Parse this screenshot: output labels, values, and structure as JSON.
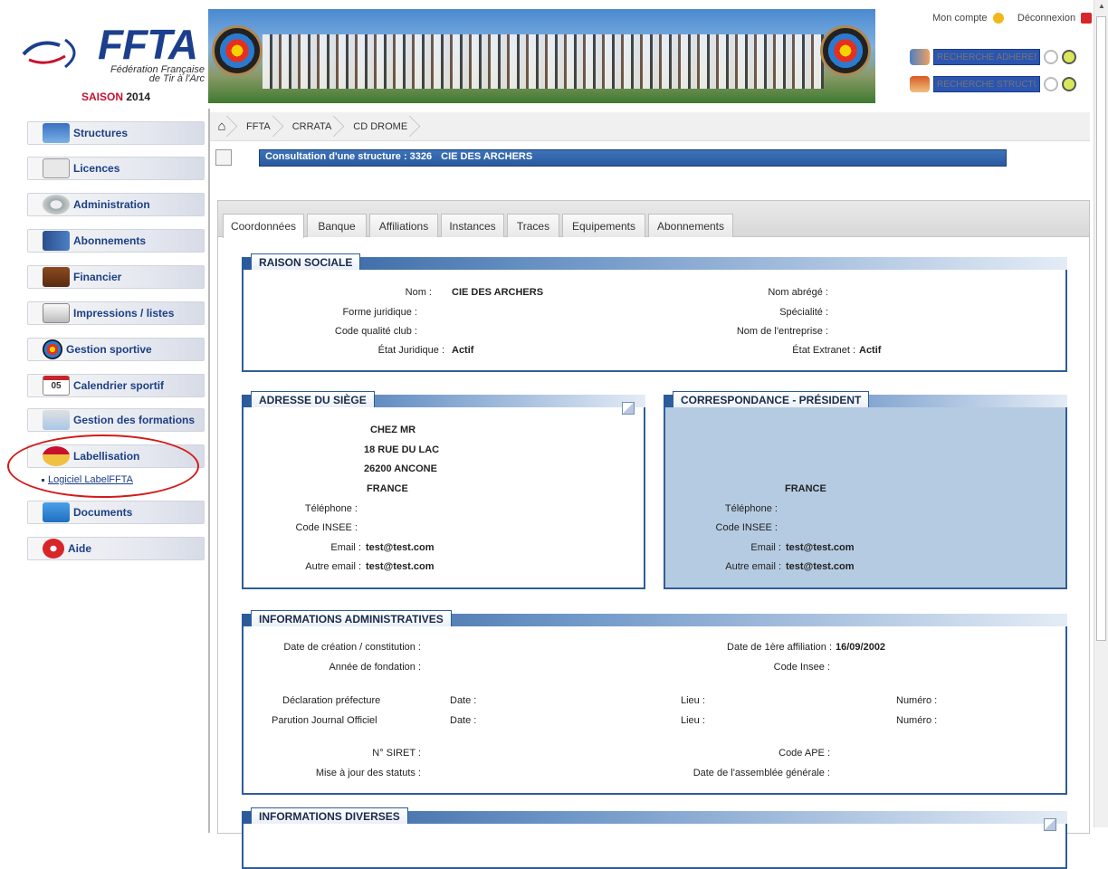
{
  "logo": {
    "brand": "FFTA",
    "federation_line1": "Fédération Française",
    "federation_line2": "de Tir à l'Arc",
    "season_label": "SAISON",
    "season_year": "2014"
  },
  "header": {
    "account_label": "Mon compte",
    "logout_label": "Déconnexion",
    "search_member_placeholder": "RECHERCHE ADHÉRENT",
    "search_structure_placeholder": "RECHERCHE STRUCTURE"
  },
  "sidebar": {
    "items": [
      {
        "label": "Structures",
        "icon": "building-icon"
      },
      {
        "label": "Licences",
        "icon": "card-icon"
      },
      {
        "label": "Administration",
        "icon": "gears-icon"
      },
      {
        "label": "Abonnements",
        "icon": "people-icon"
      },
      {
        "label": "Financier",
        "icon": "briefcase-icon"
      },
      {
        "label": "Impressions / listes",
        "icon": "printer-icon"
      },
      {
        "label": "Gestion sportive",
        "icon": "target-icon"
      },
      {
        "label": "Calendrier sportif",
        "icon": "calendar-icon"
      },
      {
        "label": "Gestion des formations",
        "icon": "board-icon"
      },
      {
        "label": "Labellisation",
        "icon": "medal-icon"
      },
      {
        "label": "Documents",
        "icon": "folder-icon"
      },
      {
        "label": "Aide",
        "icon": "help-icon"
      }
    ],
    "calendar_day": "05",
    "sub_item": "Logiciel LabelFFTA"
  },
  "breadcrumb": [
    "FFTA",
    "CRRATA",
    "CD DROME"
  ],
  "page_title": {
    "prefix": "Consultation d'une structure : 3326",
    "name": "CIE DES ARCHERS"
  },
  "tabs": [
    "Coordonnées",
    "Banque",
    "Affiliations",
    "Instances",
    "Traces",
    "Equipements",
    "Abonnements"
  ],
  "raison_sociale": {
    "title": "RAISON SOCIALE",
    "nom_label": "Nom :",
    "nom_value": "CIE DES ARCHERS",
    "forme_label": "Forme juridique :",
    "code_qualite_label": "Code qualité club :",
    "etat_juridique_label": "État Juridique :",
    "etat_juridique_value": "Actif",
    "nom_abrege_label": "Nom abrégé :",
    "specialite_label": "Spécialité :",
    "entreprise_label": "Nom de l'entreprise :",
    "etat_extranet_label": "État Extranet :",
    "etat_extranet_value": "Actif"
  },
  "adresse": {
    "title": "ADRESSE DU SIÈGE",
    "line1": "CHEZ MR",
    "line2": "18 RUE DU LAC",
    "line3": "26200 ANCONE",
    "line4": "FRANCE",
    "tel_label": "Téléphone :",
    "insee_label": "Code INSEE :",
    "email_label": "Email :",
    "email_value": "test@test.com",
    "autre_email_label": "Autre email :",
    "autre_email_value": "test@test.com"
  },
  "correspondance": {
    "title": "CORRESPONDANCE - PRÉSIDENT",
    "country": "FRANCE",
    "tel_label": "Téléphone :",
    "insee_label": "Code INSEE :",
    "email_label": "Email :",
    "email_value": "test@test.com",
    "autre_email_label": "Autre email :",
    "autre_email_value": "test@test.com"
  },
  "info_admin": {
    "title": "INFORMATIONS ADMINISTRATIVES",
    "creation_label": "Date de création / constitution :",
    "fondation_label": "Année de fondation :",
    "affiliation_label": "Date de 1ère affiliation :",
    "affiliation_value": "16/09/2002",
    "code_insee_label": "Code Insee :",
    "declaration_label": "Déclaration préfecture",
    "parution_label": "Parution Journal Officiel",
    "date_label": "Date :",
    "lieu_label": "Lieu :",
    "numero_label": "Numéro :",
    "siret_label": "N° SIRET :",
    "ape_label": "Code APE :",
    "statuts_label": "Mise à jour des statuts :",
    "assemblee_label": "Date de l'assemblée générale :"
  },
  "info_diverses": {
    "title": "INFORMATIONS DIVERSES"
  }
}
